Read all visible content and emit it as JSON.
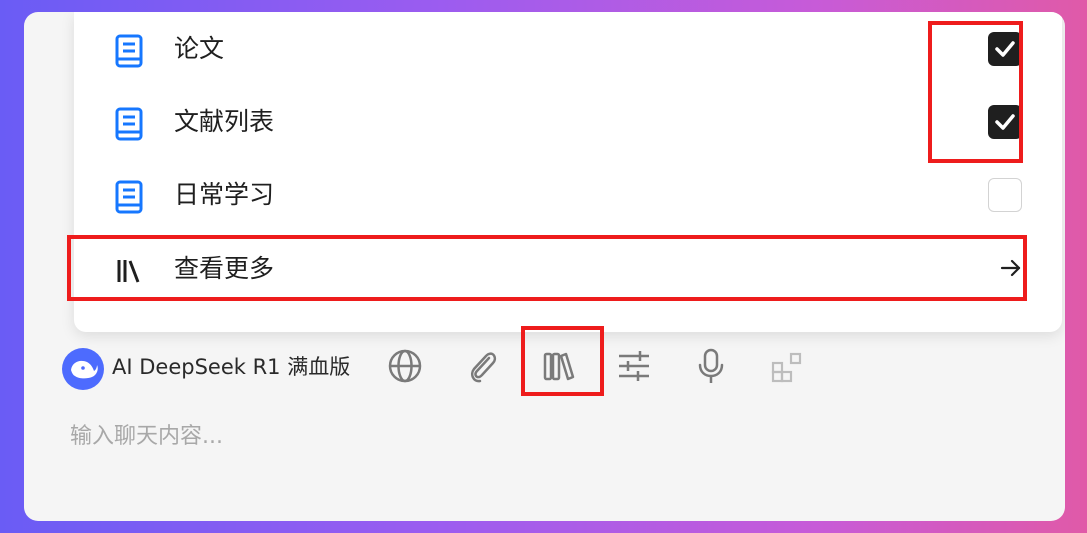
{
  "menu": {
    "items": [
      {
        "label": "论文",
        "checked": true,
        "icon": "document-icon"
      },
      {
        "label": "文献列表",
        "checked": true,
        "icon": "document-icon"
      },
      {
        "label": "日常学习",
        "checked": false,
        "icon": "document-icon"
      }
    ],
    "more": {
      "label": "查看更多",
      "icon": "library-icon",
      "arrow": "arrow-right-icon"
    }
  },
  "toolbar": {
    "model_name": "AI DeepSeek R1 满血版",
    "model_icon": "deepseek-whale-icon",
    "tools": [
      "globe-icon",
      "paperclip-icon",
      "library-icon",
      "sliders-icon",
      "microphone-icon",
      "apps-icon"
    ]
  },
  "input": {
    "placeholder": "输入聊天内容..."
  },
  "colors": {
    "accent_blue": "#1677ff",
    "highlight_red": "#ee1c1c",
    "check_dark": "#1f1f1f"
  }
}
